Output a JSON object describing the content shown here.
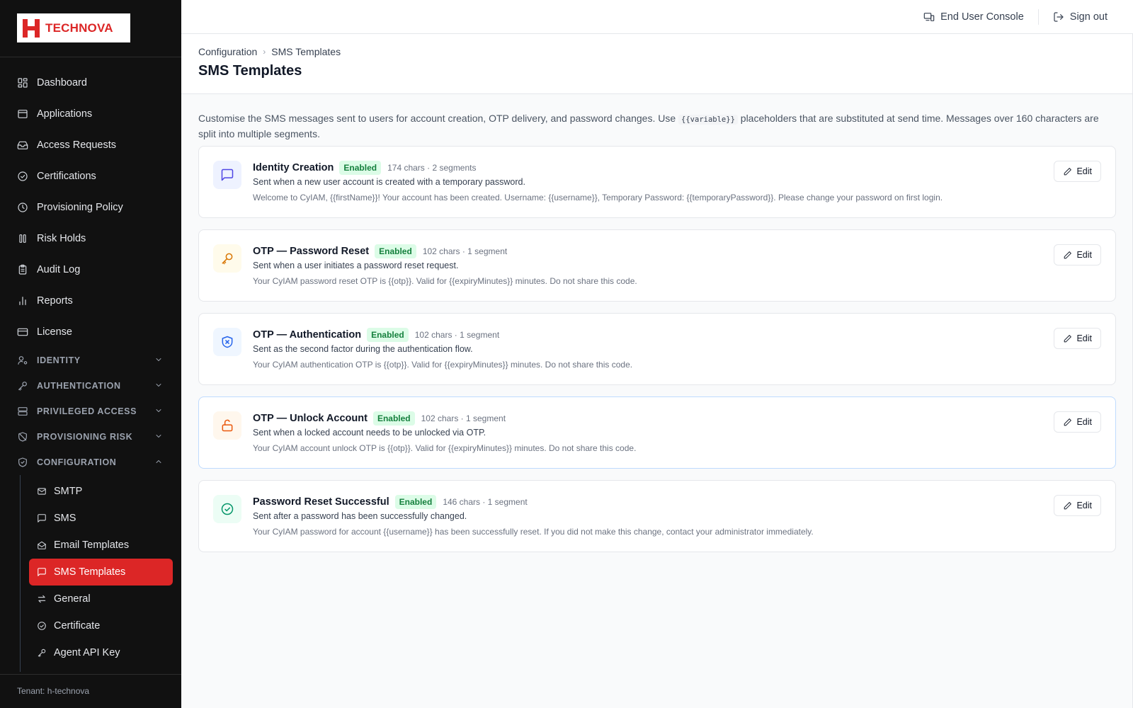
{
  "brand": {
    "name": "TECHNOVA",
    "accent": "#dc2626"
  },
  "sidebar": {
    "items": [
      {
        "label": "Dashboard",
        "icon": "dashboard-icon"
      },
      {
        "label": "Applications",
        "icon": "window-icon"
      },
      {
        "label": "Access Requests",
        "icon": "inbox-icon"
      },
      {
        "label": "Certifications",
        "icon": "check-circle-icon"
      },
      {
        "label": "Provisioning Policy",
        "icon": "clock-icon"
      },
      {
        "label": "Risk Holds",
        "icon": "pause-icon"
      },
      {
        "label": "Audit Log",
        "icon": "clipboard-icon"
      },
      {
        "label": "Reports",
        "icon": "bar-chart-icon"
      },
      {
        "label": "License",
        "icon": "card-icon"
      }
    ],
    "sections": [
      {
        "label": "IDENTITY",
        "icon": "user-cog-icon"
      },
      {
        "label": "AUTHENTICATION",
        "icon": "key-icon"
      },
      {
        "label": "PRIVILEGED ACCESS",
        "icon": "server-icon"
      },
      {
        "label": "PROVISIONING RISK",
        "icon": "shield-off-icon"
      },
      {
        "label": "CONFIGURATION",
        "icon": "shield-check-icon"
      }
    ],
    "config_items": [
      {
        "label": "SMTP",
        "icon": "mail-icon"
      },
      {
        "label": "SMS",
        "icon": "message-square-icon"
      },
      {
        "label": "Email Templates",
        "icon": "mail-open-icon"
      },
      {
        "label": "SMS Templates",
        "icon": "message-square-icon",
        "active": true
      },
      {
        "label": "General",
        "icon": "arrows-icon"
      },
      {
        "label": "Certificate",
        "icon": "check-circle-icon"
      },
      {
        "label": "Agent API Key",
        "icon": "key-icon"
      }
    ],
    "tenant": "Tenant: h-technova"
  },
  "topbar": {
    "end_user_console": "End User Console",
    "sign_out": "Sign out"
  },
  "breadcrumb": {
    "parent": "Configuration",
    "sep": "›",
    "current": "SMS Templates"
  },
  "page_title": "SMS Templates",
  "intro": {
    "before": "Customise the SMS messages sent to users for account creation, OTP delivery, and password changes. Use ",
    "code": "{{variable}}",
    "after": " placeholders that are substituted at send time. Messages over 160 characters are split into multiple segments."
  },
  "templates": [
    {
      "title": "Identity Creation",
      "status": "Enabled",
      "meta": "174 chars · 2 segments",
      "description": "Sent when a new user account is created with a temporary password.",
      "body": "Welcome to CyIAM, {{firstName}}! Your account has been created. Username: {{username}}, Temporary Password: {{temporaryPassword}}. Please change your password on first login.",
      "icon": "message-square-icon",
      "edit_label": "Edit"
    },
    {
      "title": "OTP — Password Reset",
      "status": "Enabled",
      "meta": "102 chars · 1 segment",
      "description": "Sent when a user initiates a password reset request.",
      "body": "Your CyIAM password reset OTP is {{otp}}. Valid for {{expiryMinutes}} minutes. Do not share this code.",
      "icon": "key-icon",
      "edit_label": "Edit"
    },
    {
      "title": "OTP — Authentication",
      "status": "Enabled",
      "meta": "102 chars · 1 segment",
      "description": "Sent as the second factor during the authentication flow.",
      "body": "Your CyIAM authentication OTP is {{otp}}. Valid for {{expiryMinutes}} minutes. Do not share this code.",
      "icon": "shield-x-icon",
      "edit_label": "Edit"
    },
    {
      "title": "OTP — Unlock Account",
      "status": "Enabled",
      "meta": "102 chars · 1 segment",
      "description": "Sent when a locked account needs to be unlocked via OTP.",
      "body": "Your CyIAM account unlock OTP is {{otp}}. Valid for {{expiryMinutes}} minutes. Do not share this code.",
      "icon": "unlock-icon",
      "edit_label": "Edit"
    },
    {
      "title": "Password Reset Successful",
      "status": "Enabled",
      "meta": "146 chars · 1 segment",
      "description": "Sent after a password has been successfully changed.",
      "body": "Your CyIAM password for account {{username}} has been successfully reset. If you did not make this change, contact your administrator immediately.",
      "icon": "check-circle-icon",
      "edit_label": "Edit"
    }
  ]
}
